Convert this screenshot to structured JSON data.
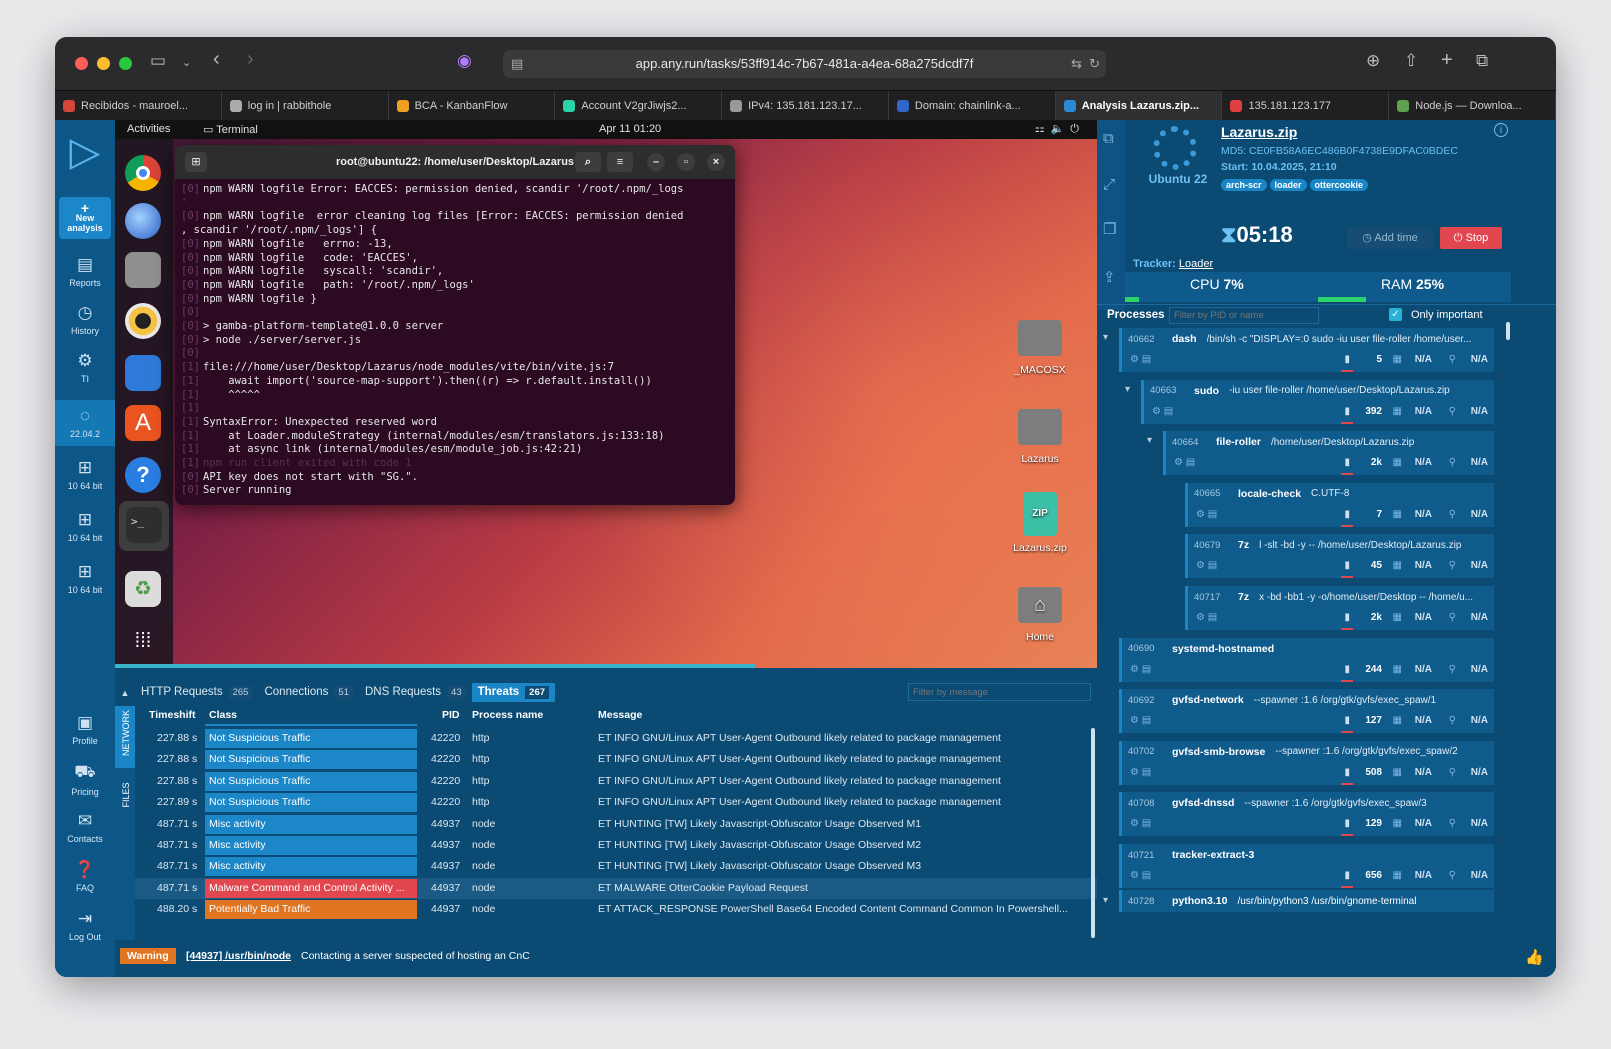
{
  "browser": {
    "url": "app.any.run/tasks/53ff914c-7b67-481a-a4ea-68a275dcdf7f",
    "tabs": [
      {
        "label": "Recibidos - mauroel...",
        "color": "#d44638"
      },
      {
        "label": "log in | rabbithole",
        "color": "#aaaaaa"
      },
      {
        "label": "BCA - KanbanFlow",
        "color": "#f0a020"
      },
      {
        "label": "Account V2grJiwjs2...",
        "color": "#2bd4a8"
      },
      {
        "label": "IPv4: 135.181.123.17...",
        "color": "#999999"
      },
      {
        "label": "Domain: chainlink-a...",
        "color": "#3366cc"
      },
      {
        "label": "Analysis Lazarus.zip...",
        "color": "#2a8ad4",
        "active": true
      },
      {
        "label": "135.181.123.177",
        "color": "#e04040"
      },
      {
        "label": "Node.js — Downloa...",
        "color": "#5fa04e"
      }
    ]
  },
  "nav": {
    "new_analysis": "New analysis",
    "reports": "Reports",
    "history": "History",
    "ti": "TI",
    "ubuntu": "22.04.2",
    "win1": "10 64 bit",
    "win2": "10 64 bit",
    "win3": "10 64 bit",
    "profile": "Profile",
    "pricing": "Pricing",
    "contacts": "Contacts",
    "faq": "FAQ",
    "logout": "Log Out"
  },
  "vm": {
    "activities": "Activities",
    "app_name": "Terminal",
    "clock": "Apr 11  01:20",
    "terminal_title": "root@ubuntu22: /home/user/Desktop/Lazarus",
    "lines": [
      {
        "p": "[0]",
        "t": "npm WARN logfile Error: EACCES: permission denied, scandir '/root/.npm/_logs"
      },
      {
        "p": "'",
        "t": ""
      },
      {
        "p": "[0]",
        "t": "npm WARN logfile  error cleaning log files [Error: EACCES: permission denied"
      },
      {
        "p": ", scandir '/root/.npm/_logs'] {",
        "t": ""
      },
      {
        "p": "[0]",
        "t": "npm WARN logfile   errno: -13,"
      },
      {
        "p": "[0]",
        "t": "npm WARN logfile   code: 'EACCES',"
      },
      {
        "p": "[0]",
        "t": "npm WARN logfile   syscall: 'scandir',"
      },
      {
        "p": "[0]",
        "t": "npm WARN logfile   path: '/root/.npm/_logs'"
      },
      {
        "p": "[0]",
        "t": "npm WARN logfile }"
      },
      {
        "p": "[0]",
        "t": ""
      },
      {
        "p": "[0]",
        "t": "> gamba-platform-template@1.0.0 server"
      },
      {
        "p": "[0]",
        "t": "> node ./server/server.js"
      },
      {
        "p": "[0]",
        "t": ""
      },
      {
        "p": "[1]",
        "t": "file:///home/user/Desktop/Lazarus/node_modules/vite/bin/vite.js:7"
      },
      {
        "p": "[1]",
        "t": "    await import('source-map-support').then((r) => r.default.install())"
      },
      {
        "p": "[1]",
        "t": "    ^^^^^"
      },
      {
        "p": "[1]",
        "t": ""
      },
      {
        "p": "[1]",
        "t": "SyntaxError: Unexpected reserved word"
      },
      {
        "p": "[1]",
        "t": "    at Loader.moduleStrategy (internal/modules/esm/translators.js:133:18)"
      },
      {
        "p": "[1]",
        "t": "    at async link (internal/modules/esm/module_job.js:42:21)"
      },
      {
        "p": "[1]",
        "t": "npm run client exited with code 1"
      },
      {
        "p": "[0]",
        "t": "API key does not start with \"SG.\"."
      },
      {
        "p": "[0]",
        "t": "Server running"
      }
    ],
    "desktop": [
      "_MACOSX",
      "Lazarus",
      "Lazarus.zip",
      "Home"
    ]
  },
  "task": {
    "os": "Ubuntu 22",
    "filename": "Lazarus.zip",
    "md5": "MD5: CE0FB58A6EC486B0F4738E9DFAC0BDEC",
    "start": "Start: 10.04.2025, 21:10",
    "tags": [
      "arch-scr",
      "loader",
      "ottercookie"
    ],
    "timer": "05:18",
    "add_time": "Add time",
    "stop": "Stop",
    "tracker_label": "Tracker:",
    "tracker_value": "Loader",
    "cpu_label": "CPU",
    "cpu": "7%",
    "cpu_frac": 0.07,
    "ram_label": "RAM",
    "ram": "25%",
    "ram_frac": 0.25
  },
  "processes": {
    "title": "Processes",
    "filter_placeholder": "Filter by PID or name",
    "only_important": "Only important",
    "items": [
      {
        "pid": "40662",
        "name": "dash",
        "cmd": "/bin/sh -c \"DISPLAY=:0 sudo -iu user file-roller /home/user...",
        "count": "5",
        "depth": 0
      },
      {
        "pid": "40663",
        "name": "sudo",
        "cmd": "-iu user file-roller /home/user/Desktop/Lazarus.zip",
        "count": "392",
        "depth": 1
      },
      {
        "pid": "40664",
        "name": "file-roller",
        "cmd": "/home/user/Desktop/Lazarus.zip",
        "count": "2k",
        "depth": 2
      },
      {
        "pid": "40665",
        "name": "locale-check",
        "cmd": "C.UTF-8",
        "count": "7",
        "depth": 3
      },
      {
        "pid": "40679",
        "name": "7z",
        "cmd": "l -slt -bd -y -- /home/user/Desktop/Lazarus.zip",
        "count": "45",
        "depth": 3
      },
      {
        "pid": "40717",
        "name": "7z",
        "cmd": "x -bd -bb1 -y -o/home/user/Desktop -- /home/u...",
        "count": "2k",
        "depth": 3
      },
      {
        "pid": "40690",
        "name": "systemd-hostnamed",
        "cmd": "",
        "count": "244",
        "depth": 0
      },
      {
        "pid": "40692",
        "name": "gvfsd-network",
        "cmd": "--spawner :1.6 /org/gtk/gvfs/exec_spaw/1",
        "count": "127",
        "depth": 0
      },
      {
        "pid": "40702",
        "name": "gvfsd-smb-browse",
        "cmd": "--spawner :1.6 /org/gtk/gvfs/exec_spaw/2",
        "count": "508",
        "depth": 0
      },
      {
        "pid": "40708",
        "name": "gvfsd-dnssd",
        "cmd": "--spawner :1.6 /org/gtk/gvfs/exec_spaw/3",
        "count": "129",
        "depth": 0
      },
      {
        "pid": "40721",
        "name": "tracker-extract-3",
        "cmd": "",
        "count": "656",
        "depth": 0
      }
    ],
    "last": {
      "pid": "40728",
      "name": "python3.10",
      "cmd": "/usr/bin/python3 /usr/bin/gnome-terminal"
    },
    "na": "N/A"
  },
  "bottom": {
    "tabs": [
      {
        "label": "HTTP Requests",
        "count": "265"
      },
      {
        "label": "Connections",
        "count": "51"
      },
      {
        "label": "DNS Requests",
        "count": "43"
      },
      {
        "label": "Threats",
        "count": "267",
        "active": true
      }
    ],
    "filter_placeholder": "Filter by message",
    "vtab_network": "NETWORK",
    "vtab_files": "FILES",
    "headers": {
      "time": "Timeshift",
      "class": "Class",
      "pid": "PID",
      "proc": "Process name",
      "msg": "Message"
    },
    "rows": [
      {
        "time": "227.88 s",
        "cls": "Not Suspicious Traffic",
        "color": "#1b86c8",
        "pid": "42220",
        "proc": "http",
        "msg": "ET INFO GNU/Linux APT User-Agent Outbound likely related to package management"
      },
      {
        "time": "227.88 s",
        "cls": "Not Suspicious Traffic",
        "color": "#1b86c8",
        "pid": "42220",
        "proc": "http",
        "msg": "ET INFO GNU/Linux APT User-Agent Outbound likely related to package management"
      },
      {
        "time": "227.88 s",
        "cls": "Not Suspicious Traffic",
        "color": "#1b86c8",
        "pid": "42220",
        "proc": "http",
        "msg": "ET INFO GNU/Linux APT User-Agent Outbound likely related to package management"
      },
      {
        "time": "227.89 s",
        "cls": "Not Suspicious Traffic",
        "color": "#1b86c8",
        "pid": "42220",
        "proc": "http",
        "msg": "ET INFO GNU/Linux APT User-Agent Outbound likely related to package management"
      },
      {
        "time": "487.71 s",
        "cls": "Misc activity",
        "color": "#1b86c8",
        "pid": "44937",
        "proc": "node",
        "msg": "ET HUNTING [TW] Likely Javascript-Obfuscator Usage Observed M1"
      },
      {
        "time": "487.71 s",
        "cls": "Misc activity",
        "color": "#1b86c8",
        "pid": "44937",
        "proc": "node",
        "msg": "ET HUNTING [TW] Likely Javascript-Obfuscator Usage Observed M2"
      },
      {
        "time": "487.71 s",
        "cls": "Misc activity",
        "color": "#1b86c8",
        "pid": "44937",
        "proc": "node",
        "msg": "ET HUNTING [TW] Likely Javascript-Obfuscator Usage Observed M3"
      },
      {
        "time": "487.71 s",
        "cls": "Malware Command and Control Activity ...",
        "color": "#e2474f",
        "pid": "44937",
        "proc": "node",
        "msg": "ET MALWARE OtterCookie Payload Request"
      },
      {
        "time": "488.20 s",
        "cls": "Potentially Bad Traffic",
        "color": "#e07420",
        "pid": "44937",
        "proc": "node",
        "msg": "ET ATTACK_RESPONSE PowerShell Base64 Encoded Content Command Common In Powershell..."
      }
    ]
  },
  "status": {
    "level": "Warning",
    "process": "[44937] /usr/bin/node",
    "message": "Contacting a server suspected of hosting an CnC"
  }
}
